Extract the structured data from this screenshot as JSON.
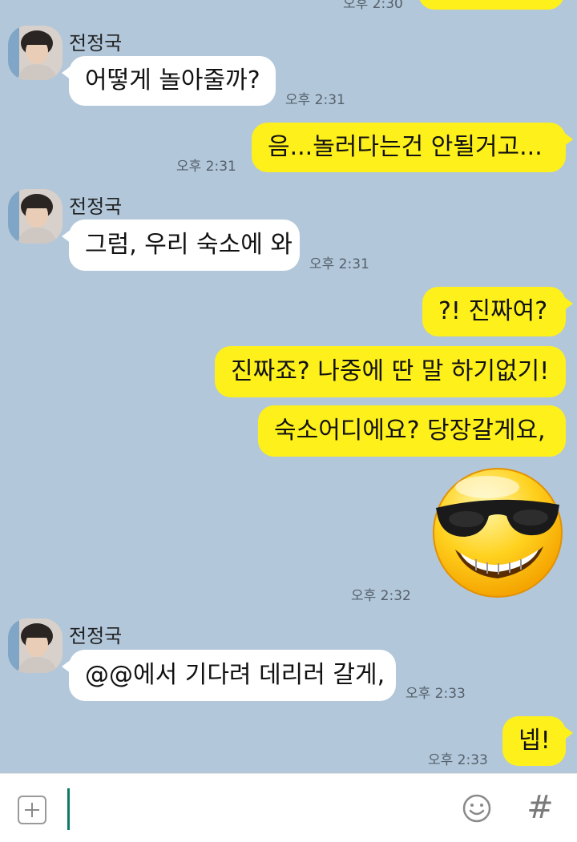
{
  "contact": {
    "name": "전정국"
  },
  "messages": [
    {
      "side": "out",
      "text": "",
      "time": "오후 2:30"
    },
    {
      "side": "in",
      "text": "어떻게 놀아줄까?",
      "time": "오후 2:31"
    },
    {
      "side": "out",
      "text": "음...놀러다는건 안될거고...",
      "time": "오후 2:31"
    },
    {
      "side": "in",
      "text": "그럼, 우리 숙소에 와",
      "time": "오후 2:31"
    },
    {
      "side": "out",
      "text": "?! 진짜여?",
      "time": ""
    },
    {
      "side": "out",
      "text": "진짜죠? 나중에 딴 말 하기없기!",
      "time": ""
    },
    {
      "side": "out",
      "text": "숙소어디에요? 당장갈게요,",
      "time": ""
    },
    {
      "side": "out",
      "text": "",
      "sticker": "sunglasses-smiley",
      "time": "오후 2:32"
    },
    {
      "side": "in",
      "text": "@@에서 기다려 데리러 갈게,",
      "time": "오후 2:33"
    },
    {
      "side": "out",
      "text": "넵!",
      "time": "오후 2:33"
    }
  ],
  "input": {
    "value": "",
    "placeholder": ""
  },
  "icons": {
    "attach": "plus-icon",
    "emoticon": "smile-icon",
    "hashtag": "hash-icon"
  },
  "colors": {
    "background": "#b2c7da",
    "outgoing_bubble": "#fef01b",
    "incoming_bubble": "#ffffff",
    "cursor": "#0b7a67"
  },
  "hash_symbol": "#"
}
